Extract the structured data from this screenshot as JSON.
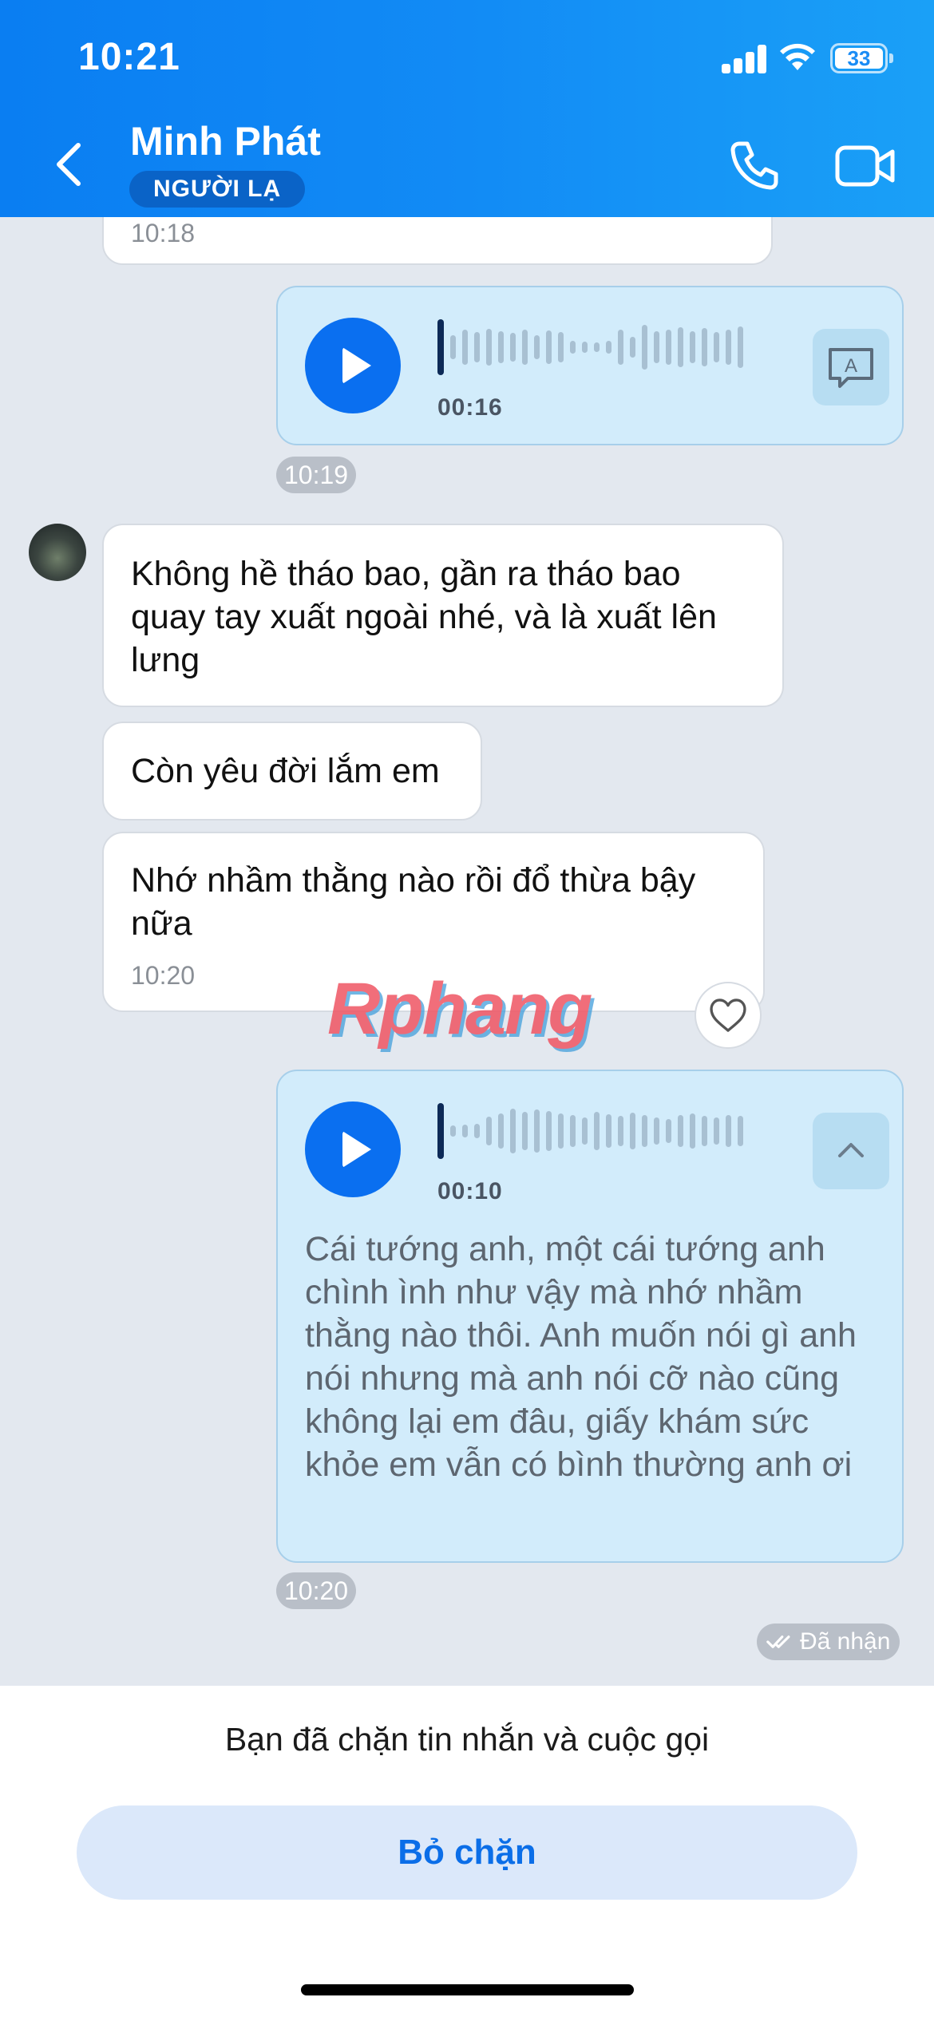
{
  "status_bar": {
    "time": "10:21",
    "battery": "33"
  },
  "header": {
    "contact_name": "Minh Phát",
    "badge": "NGƯỜI LẠ"
  },
  "messages": {
    "partial_time": "10:18",
    "voice_1": {
      "duration": "00:16",
      "time": "10:19"
    },
    "text_1": "Không hề tháo bao, gần ra tháo bao quay tay xuất ngoài nhé, và là xuất lên lưng",
    "text_2": "Còn yêu đời lắm em",
    "text_3": "Nhớ nhầm thằng nào rồi đổ thừa bậy nữa",
    "text_3_time": "10:20",
    "voice_2": {
      "duration": "00:10",
      "transcript": "Cái tướng anh, một cái tướng anh chình ình như vậy mà nhớ nhầm thằng nào thôi. Anh muốn nói gì anh nói nhưng mà anh nói cỡ nào cũng không lại em đâu, giấy khám sức khỏe em vẫn có bình thường anh ơi",
      "time": "10:20"
    },
    "delivery_status": "Đã nhận"
  },
  "watermark": "Rphang",
  "bottom": {
    "blocked_note": "Bạn đã chặn tin nhắn và cuộc gọi",
    "unblock_label": "Bỏ chặn"
  },
  "colors": {
    "header_start": "#0a7ef2",
    "header_end": "#1aa0f7",
    "accent": "#0a6ff0",
    "outgoing_bubble": "#d2ecfb"
  },
  "icons": [
    "back-icon",
    "phone-icon",
    "video-call-icon",
    "play-icon",
    "transcribe-icon",
    "collapse-icon",
    "heart-icon",
    "double-check-icon"
  ]
}
